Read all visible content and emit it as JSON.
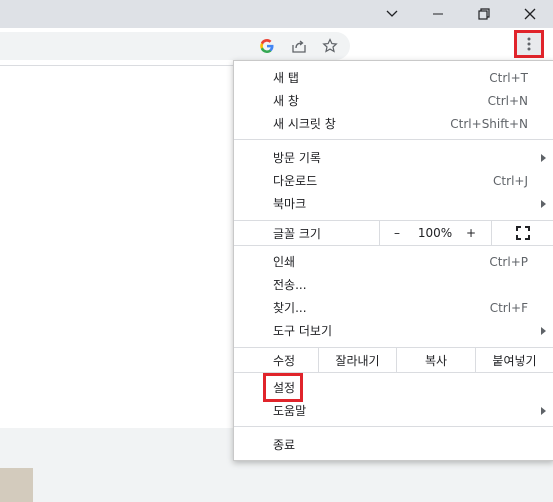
{
  "colors": {
    "highlight": "#e0242b",
    "titlebar": "#dee1e6"
  },
  "window_controls": [
    {
      "name": "chevron-down-icon"
    },
    {
      "name": "minimize-icon"
    },
    {
      "name": "restore-icon"
    },
    {
      "name": "close-icon"
    }
  ],
  "toolbar_icons": [
    "google-icon",
    "share-icon",
    "bookmark-star-icon",
    "more-vert-icon"
  ],
  "menu": {
    "new_tab": {
      "label": "새 탭",
      "shortcut": "Ctrl+T"
    },
    "new_window": {
      "label": "새 창",
      "shortcut": "Ctrl+N"
    },
    "incognito": {
      "label": "새 시크릿 창",
      "shortcut": "Ctrl+Shift+N"
    },
    "history": {
      "label": "방문 기록"
    },
    "downloads": {
      "label": "다운로드",
      "shortcut": "Ctrl+J"
    },
    "bookmarks": {
      "label": "북마크"
    },
    "zoom": {
      "label": "글꼴 크기",
      "minus": "–",
      "value": "100%",
      "plus": "+"
    },
    "print": {
      "label": "인쇄",
      "shortcut": "Ctrl+P"
    },
    "cast": {
      "label": "전송..."
    },
    "find": {
      "label": "찾기...",
      "shortcut": "Ctrl+F"
    },
    "more_tools": {
      "label": "도구 더보기"
    },
    "edit": {
      "label": "수정",
      "cut": "잘라내기",
      "copy": "복사",
      "paste": "붙여넣기"
    },
    "settings": {
      "label": "설정"
    },
    "help": {
      "label": "도움말"
    },
    "exit": {
      "label": "종료"
    }
  }
}
